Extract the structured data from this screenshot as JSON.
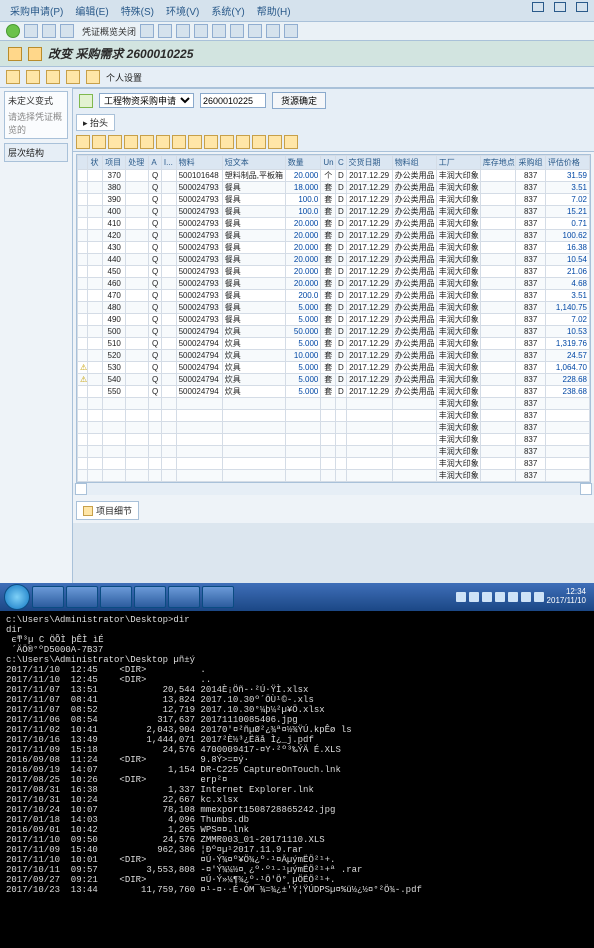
{
  "menu": {
    "items": [
      "采购申请(P)",
      "编辑(E)",
      "特殊(S)",
      "环境(V)",
      "系统(Y)",
      "帮助(H)"
    ]
  },
  "toolbar1": {
    "label": "凭证概览关闭"
  },
  "title": "改变 采购需求 2600010225",
  "toolbar2": {
    "icons": [
      "btn-a",
      "btn-b",
      "btn-c",
      "btn-d"
    ],
    "last": "个人设置",
    "dropdown": {
      "selected": "工程物资采购申请",
      "options": [
        "工程物资采购申请"
      ]
    },
    "number": "2600010225",
    "btn": "货源确定"
  },
  "left": {
    "box1_title": "未定义变式",
    "box1_hint": "请选择凭证概览的",
    "tab": "层次结构"
  },
  "grid": {
    "tabs": [
      "抬头"
    ],
    "cols": [
      "",
      "状",
      "项目",
      "处理",
      "A",
      "I...",
      "物料",
      "短文本",
      "数量",
      "Un",
      "C",
      "交货日期",
      "物料组",
      "工厂",
      "库存地点",
      "采购组",
      "评估价格"
    ],
    "rows": [
      {
        "i": "370",
        "a": "Q",
        "m": "500101648",
        "t": "塑料制品,平板箱",
        "q": "20.000",
        "u": "个",
        "d": "2017.12.29",
        "g": "办公类用品",
        "p": "丰润大印象",
        "s": "",
        "pg": "837",
        "v": "31.59"
      },
      {
        "i": "380",
        "a": "Q",
        "m": "500024793",
        "t": "餐具",
        "q": "18.000",
        "u": "套",
        "d": "2017.12.29",
        "g": "办公类用品",
        "p": "丰润大印象",
        "s": "",
        "pg": "837",
        "v": "3.51"
      },
      {
        "i": "390",
        "a": "Q",
        "m": "500024793",
        "t": "餐具",
        "q": "100.0",
        "u": "套",
        "d": "2017.12.29",
        "g": "办公类用品",
        "p": "丰润大印象",
        "s": "",
        "pg": "837",
        "v": "7.02"
      },
      {
        "i": "400",
        "a": "Q",
        "m": "500024793",
        "t": "餐具",
        "q": "100.0",
        "u": "套",
        "d": "2017.12.29",
        "g": "办公类用品",
        "p": "丰润大印象",
        "s": "",
        "pg": "837",
        "v": "15.21"
      },
      {
        "i": "410",
        "a": "Q",
        "m": "500024793",
        "t": "餐具",
        "q": "20.000",
        "u": "套",
        "d": "2017.12.29",
        "g": "办公类用品",
        "p": "丰润大印象",
        "s": "",
        "pg": "837",
        "v": "0.71"
      },
      {
        "i": "420",
        "a": "Q",
        "m": "500024793",
        "t": "餐具",
        "q": "20.000",
        "u": "套",
        "d": "2017.12.29",
        "g": "办公类用品",
        "p": "丰润大印象",
        "s": "",
        "pg": "837",
        "v": "100.62"
      },
      {
        "i": "430",
        "a": "Q",
        "m": "500024793",
        "t": "餐具",
        "q": "20.000",
        "u": "套",
        "d": "2017.12.29",
        "g": "办公类用品",
        "p": "丰润大印象",
        "s": "",
        "pg": "837",
        "v": "16.38"
      },
      {
        "i": "440",
        "a": "Q",
        "m": "500024793",
        "t": "餐具",
        "q": "20.000",
        "u": "套",
        "d": "2017.12.29",
        "g": "办公类用品",
        "p": "丰润大印象",
        "s": "",
        "pg": "837",
        "v": "10.54"
      },
      {
        "i": "450",
        "a": "Q",
        "m": "500024793",
        "t": "餐具",
        "q": "20.000",
        "u": "套",
        "d": "2017.12.29",
        "g": "办公类用品",
        "p": "丰润大印象",
        "s": "",
        "pg": "837",
        "v": "21.06"
      },
      {
        "i": "460",
        "a": "Q",
        "m": "500024793",
        "t": "餐具",
        "q": "20.000",
        "u": "套",
        "d": "2017.12.29",
        "g": "办公类用品",
        "p": "丰润大印象",
        "s": "",
        "pg": "837",
        "v": "4.68"
      },
      {
        "i": "470",
        "a": "Q",
        "m": "500024793",
        "t": "餐具",
        "q": "200.0",
        "u": "套",
        "d": "2017.12.29",
        "g": "办公类用品",
        "p": "丰润大印象",
        "s": "",
        "pg": "837",
        "v": "3.51"
      },
      {
        "i": "480",
        "a": "Q",
        "m": "500024793",
        "t": "餐具",
        "q": "5.000",
        "u": "套",
        "d": "2017.12.29",
        "g": "办公类用品",
        "p": "丰润大印象",
        "s": "",
        "pg": "837",
        "v": "1,140.75"
      },
      {
        "i": "490",
        "a": "Q",
        "m": "500024793",
        "t": "餐具",
        "q": "5.000",
        "u": "套",
        "d": "2017.12.29",
        "g": "办公类用品",
        "p": "丰润大印象",
        "s": "",
        "pg": "837",
        "v": "7.02"
      },
      {
        "i": "500",
        "a": "Q",
        "m": "500024794",
        "t": "炊具",
        "q": "50.000",
        "u": "套",
        "d": "2017.12.29",
        "g": "办公类用品",
        "p": "丰润大印象",
        "s": "",
        "pg": "837",
        "v": "10.53"
      },
      {
        "i": "510",
        "a": "Q",
        "m": "500024794",
        "t": "炊具",
        "q": "5.000",
        "u": "套",
        "d": "2017.12.29",
        "g": "办公类用品",
        "p": "丰润大印象",
        "s": "",
        "pg": "837",
        "v": "1,319.76"
      },
      {
        "i": "520",
        "a": "Q",
        "m": "500024794",
        "t": "炊具",
        "q": "10.000",
        "u": "套",
        "d": "2017.12.29",
        "g": "办公类用品",
        "p": "丰润大印象",
        "s": "",
        "pg": "837",
        "v": "24.57"
      },
      {
        "i": "530",
        "a": "Q",
        "m": "500024794",
        "t": "炊具",
        "q": "5.000",
        "u": "套",
        "d": "2017.12.29",
        "g": "办公类用品",
        "p": "丰润大印象",
        "s": "",
        "pg": "837",
        "v": "1,064.70",
        "warn": true
      },
      {
        "i": "540",
        "a": "Q",
        "m": "500024794",
        "t": "炊具",
        "q": "5.000",
        "u": "套",
        "d": "2017.12.29",
        "g": "办公类用品",
        "p": "丰润大印象",
        "s": "",
        "pg": "837",
        "v": "228.68",
        "warn": true
      },
      {
        "i": "550",
        "a": "Q",
        "m": "500024794",
        "t": "炊具",
        "q": "5.000",
        "u": "套",
        "d": "2017.12.29",
        "g": "办公类用品",
        "p": "丰润大印象",
        "s": "",
        "pg": "837",
        "v": "238.68"
      }
    ],
    "empty_rows_plant": "丰润大印象",
    "empty_rows_pg": "837",
    "empty_count": 7
  },
  "detail_btn": "项目细节",
  "taskbar": {
    "apps": 6,
    "clock": {
      "time": "12:34",
      "date": "2017/11/10"
    }
  },
  "term": {
    "lines": [
      "c:\\Users\\Administrator\\Desktop>dir",
      "dir",
      " ϵͳ³µ C ÖÕÌ þÊÌ ìÉ",
      " ´ÄÖ®°ºD5000A-7B37",
      "",
      "c:\\Users\\Administrator\\Desktop µñ±ý",
      "",
      "2017/11/10  12:45    <DIR>          .",
      "2017/11/10  12:45    <DIR>          ..",
      "2017/11/07  13:51            20,544 2014È¡Öñ-·²Ú·ŸÌ.xlsx",
      "2017/11/07  08:41            13,824 2017.10.30º´ÖÙ¹©-.xls",
      "2017/11/07  08:52            12,719 2017.10.30°¼þ¼²µ¥Ö.xlsx",
      "2017/11/06  08:54           317,637 20171110085406.jpg",
      "2017/11/02  10:41         2,043,904 20170'¤²ñµØ²¿¾­ª¤½¾ŸÚ.kpÊø ls",
      "2017/10/16  13:49         1,444,071 2017²È½³¿Ëãå Ì¿_j.pdf",
      "2017/11/09  15:18            24,576 4700009417-¤Y·²º³‰ÝÄ É.XLS",
      "2016/09/08  11:24    <DIR>          9.8Ý>=¤ý·",
      "2016/09/19  14:07             1,154 DR-C225 CaptureOnTouch.lnk",
      "2017/08/25  10:26    <DIR>          erp²¤",
      "2017/08/31  16:38             1,337 Internet Explorer.lnk",
      "2017/10/31  10:24            22,667 kc.xlsx",
      "2017/10/24  10:07            78,108 mmexport1508728865242.jpg",
      "2017/01/18  14:03             4,096 Thumbs.db",
      "2016/09/01  10:42             1,265 WPS¤¤.lnk",
      "2017/11/10  09:50            24,576 ZMMR003_01-20171110.XLS",
      "2017/11/09  15:40           962,386 ¦Ðº¤µ¹2017.11.9.rar",
      "2017/11/10  10:01    <DIR>          ¤Ú·Ý¾¤º¥Ö¾¿º·¹¤ÄµýmËÖ²¹+.",
      "2017/10/11  09:57         3,553,808 -¤'Ý¾¼½¤¸¿º·º¹-¹µýmËÖ²¹+ª .rar",
      "2017/09/27  09:21    <DIR>          ¤Ú·Ý»¼¶¾¿º·¹Ö'Ö°¸µÖËÖ²¹+.",
      "2017/10/23  13:44        11,759,760 ¤¹-¤··É·ÓM¯¾=¾¿±'Ý¦ŸÚDPSµ¤%ü½¿½¤°²Ö¾-.pdf"
    ]
  }
}
